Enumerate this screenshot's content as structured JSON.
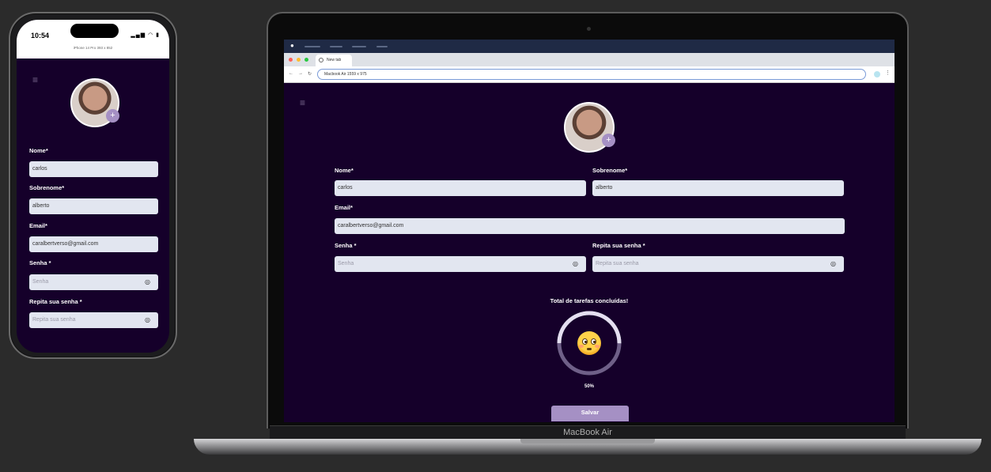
{
  "phone": {
    "time": "10:54",
    "status_icons": "▂▄▆ ◠ ▮",
    "device_label": "iPhone 14 Pro  393 x 852"
  },
  "browser": {
    "tab_title": "New tab",
    "url": "Macbook Air  1559 x 975",
    "nav_back": "←",
    "nav_forward": "→",
    "nav_reload": "↻",
    "traffic_colors": [
      "#ff5f57",
      "#febc2e",
      "#28c840"
    ]
  },
  "laptop_name": "MacBook Air",
  "menu_icon": "≡",
  "form": {
    "nome_label": "Nome*",
    "nome_value": "carlos",
    "sobrenome_label": "Sobrenome*",
    "sobrenome_value": "alberto",
    "email_label": "Email*",
    "email_value": "caralbertverso@gmail.com",
    "senha_label": "Senha *",
    "senha_placeholder": "Senha",
    "repita_label": "Repita sua senha *",
    "repita_placeholder": "Repita sua senha",
    "eye_icon": "◎"
  },
  "progress": {
    "title": "Total de tarefas concluídas!",
    "percent_label": "50%",
    "value": 0.5,
    "track_color": "#6f6088",
    "fill_color": "#e4dff0"
  },
  "save_button": "Salvar",
  "avatar_add": "+",
  "colors": {
    "background": "#15002a",
    "accent": "#a590c4",
    "input": "#e2e6f0"
  }
}
